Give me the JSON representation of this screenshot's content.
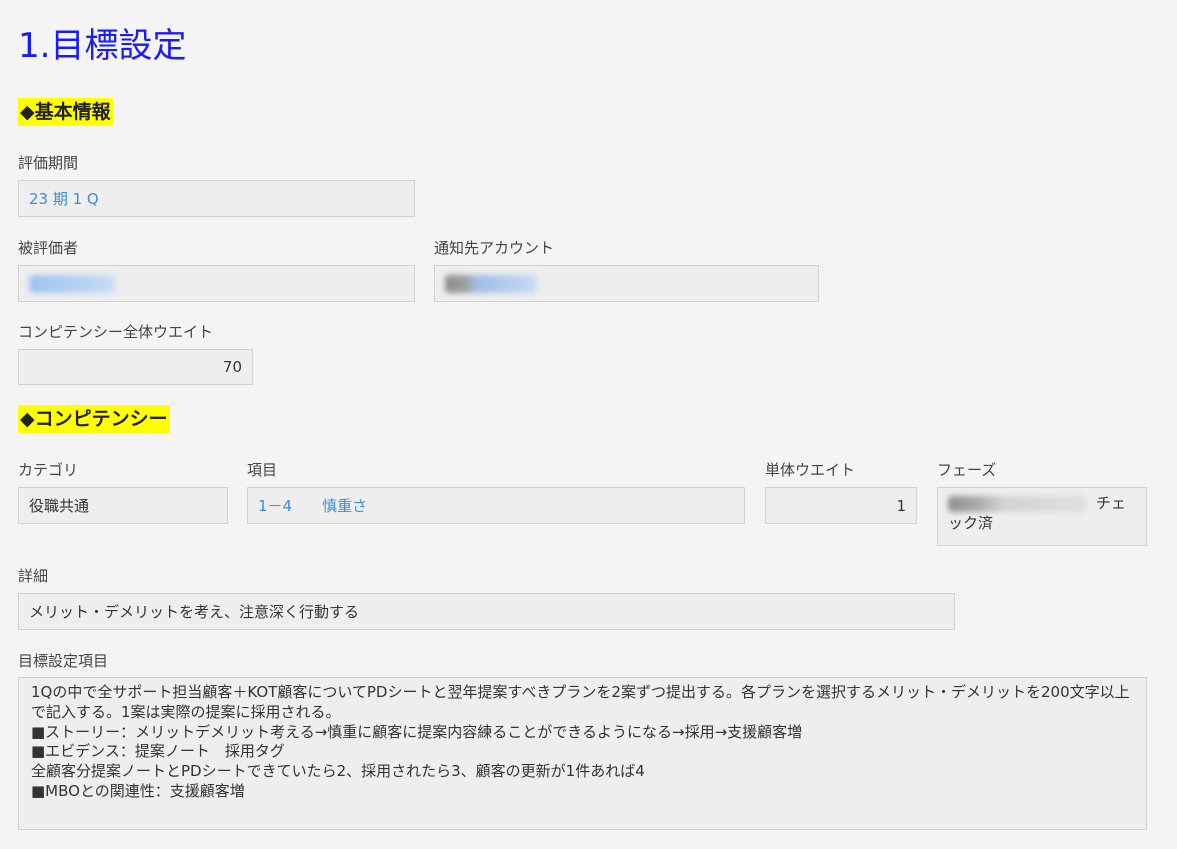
{
  "page_title": "1.目標設定",
  "section_basic": {
    "heading": "◆基本情報"
  },
  "evaluation_period": {
    "label": "評価期間",
    "value": "23 期 1 Q"
  },
  "evaluatee": {
    "label": "被評価者"
  },
  "notify_account": {
    "label": "通知先アカウント"
  },
  "competency_weight": {
    "label": "コンピテンシー全体ウエイト",
    "value": "70"
  },
  "section_competency": {
    "heading": "◆コンピテンシー"
  },
  "category": {
    "label": "カテゴリ",
    "value": "役職共通"
  },
  "item": {
    "label": "項目",
    "value": "1－4　　慎重さ"
  },
  "unit_weight": {
    "label": "単体ウエイト",
    "value": "1"
  },
  "phase": {
    "label": "フェーズ",
    "value_line1": "チェ",
    "value_line2": "ック済"
  },
  "detail": {
    "label": "詳細",
    "value": "メリット・デメリットを考え、注意深く行動する"
  },
  "goal_items": {
    "label": "目標設定項目",
    "value": "1Qの中で全サポート担当顧客＋KOT顧客についてPDシートと翌年提案すべきプランを2案ずつ提出する。各プランを選択するメリット・デメリットを200文字以上で記入する。1案は実際の提案に採用される。\n■ストーリー：メリットデメリット考える→慎重に顧客に提案内容練ることができるようになる→採用→支援顧客増\n■エビデンス：提案ノート　採用タグ\n全顧客分提案ノートとPDシートできていたら2、採用されたら3、顧客の更新が1件あれば4\n■MBOとの関連性：支援顧客増"
  },
  "colors": {
    "title": "#1a1aff",
    "highlight": "#ffff00",
    "link": "#3a8fd9"
  }
}
